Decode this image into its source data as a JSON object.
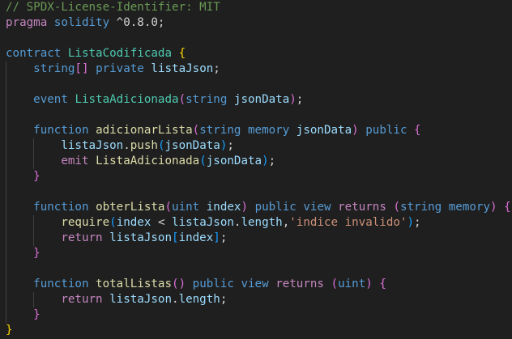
{
  "editor": {
    "language": "solidity",
    "colors": {
      "background": "#1f1f1f",
      "comment": "#6a9955",
      "keyword": "#569cd6",
      "control": "#c586c0",
      "type": "#4ec9b0",
      "function": "#dcdcaa",
      "variable": "#9cdcfe",
      "string": "#ce9178",
      "plain": "#d4d4d4",
      "bracket1": "#ffd700",
      "bracket2": "#da70d6",
      "bracket3": "#179fff"
    },
    "lines": [
      {
        "tokens": [
          {
            "t": "// SPDX-License-Identifier: MIT",
            "c": "comment"
          }
        ]
      },
      {
        "tokens": [
          {
            "t": "pragma",
            "c": "control"
          },
          {
            "t": " ",
            "c": "plain"
          },
          {
            "t": "solidity",
            "c": "keyword"
          },
          {
            "t": " ^0.8.0;",
            "c": "plain"
          }
        ]
      },
      {
        "tokens": []
      },
      {
        "tokens": [
          {
            "t": "contract",
            "c": "keyword"
          },
          {
            "t": " ",
            "c": "plain"
          },
          {
            "t": "ListaCodificada",
            "c": "type"
          },
          {
            "t": " ",
            "c": "plain"
          },
          {
            "t": "{",
            "c": "bracket1"
          }
        ]
      },
      {
        "indent": 1,
        "tokens": [
          {
            "t": "string",
            "c": "keyword"
          },
          {
            "t": "[]",
            "c": "bracket2"
          },
          {
            "t": " ",
            "c": "plain"
          },
          {
            "t": "private",
            "c": "keyword"
          },
          {
            "t": " ",
            "c": "plain"
          },
          {
            "t": "listaJson",
            "c": "variable"
          },
          {
            "t": ";",
            "c": "plain"
          }
        ]
      },
      {
        "indent": 1,
        "tokens": []
      },
      {
        "indent": 1,
        "tokens": [
          {
            "t": "event",
            "c": "keyword"
          },
          {
            "t": " ",
            "c": "plain"
          },
          {
            "t": "ListaAdicionada",
            "c": "type"
          },
          {
            "t": "(",
            "c": "bracket2"
          },
          {
            "t": "string",
            "c": "keyword"
          },
          {
            "t": " ",
            "c": "plain"
          },
          {
            "t": "jsonData",
            "c": "variable"
          },
          {
            "t": ")",
            "c": "bracket2"
          },
          {
            "t": ";",
            "c": "plain"
          }
        ]
      },
      {
        "indent": 1,
        "tokens": []
      },
      {
        "indent": 1,
        "tokens": [
          {
            "t": "function",
            "c": "keyword"
          },
          {
            "t": " ",
            "c": "plain"
          },
          {
            "t": "adicionarLista",
            "c": "function"
          },
          {
            "t": "(",
            "c": "bracket2"
          },
          {
            "t": "string",
            "c": "keyword"
          },
          {
            "t": " ",
            "c": "plain"
          },
          {
            "t": "memory",
            "c": "keyword"
          },
          {
            "t": " ",
            "c": "plain"
          },
          {
            "t": "jsonData",
            "c": "variable"
          },
          {
            "t": ")",
            "c": "bracket2"
          },
          {
            "t": " ",
            "c": "plain"
          },
          {
            "t": "public",
            "c": "keyword"
          },
          {
            "t": " ",
            "c": "plain"
          },
          {
            "t": "{",
            "c": "bracket2"
          }
        ]
      },
      {
        "indent": 2,
        "tokens": [
          {
            "t": "listaJson",
            "c": "variable"
          },
          {
            "t": ".",
            "c": "plain"
          },
          {
            "t": "push",
            "c": "function"
          },
          {
            "t": "(",
            "c": "bracket3"
          },
          {
            "t": "jsonData",
            "c": "variable"
          },
          {
            "t": ")",
            "c": "bracket3"
          },
          {
            "t": ";",
            "c": "plain"
          }
        ]
      },
      {
        "indent": 2,
        "tokens": [
          {
            "t": "emit",
            "c": "control"
          },
          {
            "t": " ",
            "c": "plain"
          },
          {
            "t": "ListaAdicionada",
            "c": "function"
          },
          {
            "t": "(",
            "c": "bracket3"
          },
          {
            "t": "jsonData",
            "c": "variable"
          },
          {
            "t": ")",
            "c": "bracket3"
          },
          {
            "t": ";",
            "c": "plain"
          }
        ]
      },
      {
        "indent": 1,
        "tokens": [
          {
            "t": "}",
            "c": "bracket2"
          }
        ]
      },
      {
        "indent": 1,
        "tokens": []
      },
      {
        "indent": 1,
        "tokens": [
          {
            "t": "function",
            "c": "keyword"
          },
          {
            "t": " ",
            "c": "plain"
          },
          {
            "t": "obterLista",
            "c": "function"
          },
          {
            "t": "(",
            "c": "bracket2"
          },
          {
            "t": "uint",
            "c": "keyword"
          },
          {
            "t": " ",
            "c": "plain"
          },
          {
            "t": "index",
            "c": "variable"
          },
          {
            "t": ")",
            "c": "bracket2"
          },
          {
            "t": " ",
            "c": "plain"
          },
          {
            "t": "public",
            "c": "keyword"
          },
          {
            "t": " ",
            "c": "plain"
          },
          {
            "t": "view",
            "c": "keyword"
          },
          {
            "t": " ",
            "c": "plain"
          },
          {
            "t": "returns",
            "c": "control"
          },
          {
            "t": " ",
            "c": "plain"
          },
          {
            "t": "(",
            "c": "bracket2"
          },
          {
            "t": "string",
            "c": "keyword"
          },
          {
            "t": " ",
            "c": "plain"
          },
          {
            "t": "memory",
            "c": "keyword"
          },
          {
            "t": ")",
            "c": "bracket2"
          },
          {
            "t": " ",
            "c": "plain"
          },
          {
            "t": "{",
            "c": "bracket2"
          }
        ]
      },
      {
        "indent": 2,
        "tokens": [
          {
            "t": "require",
            "c": "function"
          },
          {
            "t": "(",
            "c": "bracket3"
          },
          {
            "t": "index",
            "c": "variable"
          },
          {
            "t": " < ",
            "c": "plain"
          },
          {
            "t": "listaJson",
            "c": "variable"
          },
          {
            "t": ".",
            "c": "plain"
          },
          {
            "t": "length",
            "c": "variable"
          },
          {
            "t": ",",
            "c": "plain"
          },
          {
            "t": "'indice invalido'",
            "c": "string"
          },
          {
            "t": ")",
            "c": "bracket3"
          },
          {
            "t": ";",
            "c": "plain"
          }
        ]
      },
      {
        "indent": 2,
        "tokens": [
          {
            "t": "return",
            "c": "control"
          },
          {
            "t": " ",
            "c": "plain"
          },
          {
            "t": "listaJson",
            "c": "variable"
          },
          {
            "t": "[",
            "c": "bracket3"
          },
          {
            "t": "index",
            "c": "variable"
          },
          {
            "t": "]",
            "c": "bracket3"
          },
          {
            "t": ";",
            "c": "plain"
          }
        ]
      },
      {
        "indent": 1,
        "tokens": [
          {
            "t": "}",
            "c": "bracket2"
          }
        ]
      },
      {
        "indent": 1,
        "tokens": []
      },
      {
        "indent": 1,
        "tokens": [
          {
            "t": "function",
            "c": "keyword"
          },
          {
            "t": " ",
            "c": "plain"
          },
          {
            "t": "totalListas",
            "c": "function"
          },
          {
            "t": "()",
            "c": "bracket2"
          },
          {
            "t": " ",
            "c": "plain"
          },
          {
            "t": "public",
            "c": "keyword"
          },
          {
            "t": " ",
            "c": "plain"
          },
          {
            "t": "view",
            "c": "keyword"
          },
          {
            "t": " ",
            "c": "plain"
          },
          {
            "t": "returns",
            "c": "control"
          },
          {
            "t": " ",
            "c": "plain"
          },
          {
            "t": "(",
            "c": "bracket2"
          },
          {
            "t": "uint",
            "c": "keyword"
          },
          {
            "t": ")",
            "c": "bracket2"
          },
          {
            "t": " ",
            "c": "plain"
          },
          {
            "t": "{",
            "c": "bracket2"
          }
        ]
      },
      {
        "indent": 2,
        "tokens": [
          {
            "t": "return",
            "c": "control"
          },
          {
            "t": " ",
            "c": "plain"
          },
          {
            "t": "listaJson",
            "c": "variable"
          },
          {
            "t": ".",
            "c": "plain"
          },
          {
            "t": "length",
            "c": "variable"
          },
          {
            "t": ";",
            "c": "plain"
          }
        ]
      },
      {
        "indent": 1,
        "tokens": [
          {
            "t": "}",
            "c": "bracket2"
          }
        ]
      },
      {
        "tokens": [
          {
            "t": "}",
            "c": "bracket1"
          }
        ]
      }
    ]
  }
}
